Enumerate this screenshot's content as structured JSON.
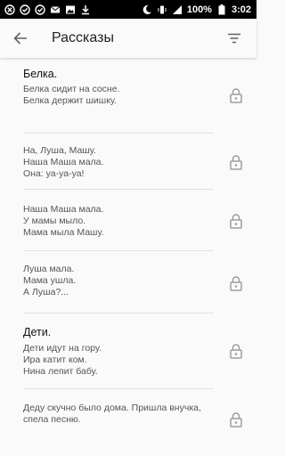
{
  "status_bar": {
    "battery": "100%",
    "time": "3:02"
  },
  "header": {
    "title": "Рассказы"
  },
  "stories": [
    {
      "title": "Белка.",
      "lines": [
        "Белка сидит на сосне.",
        "Белка держит шишку."
      ],
      "locked": true
    },
    {
      "title": "",
      "lines": [
        "На, Луша, Машу.",
        "Наша Маша мала.",
        "Она: уа-уа-уа!"
      ],
      "locked": true
    },
    {
      "title": "",
      "lines": [
        "Наша Маша мала.",
        "У мамы мыло.",
        "Мама мыла Машу."
      ],
      "locked": true
    },
    {
      "title": "",
      "lines": [
        "Луша мала.",
        "Мама ушла.",
        "А Луша?..."
      ],
      "locked": true
    },
    {
      "title": "Дети.",
      "lines": [
        "Дети идут на гору.",
        "Ира катит ком.",
        "Нина лепит бабу."
      ],
      "locked": true
    },
    {
      "title": "",
      "lines": [
        "Деду скучно было дома. Пришла внучка,",
        "спела песню."
      ],
      "locked": true
    }
  ],
  "colors": {
    "status_bar_bg": "#000000",
    "background": "#fafafa",
    "icon": "#9e9e9e"
  }
}
